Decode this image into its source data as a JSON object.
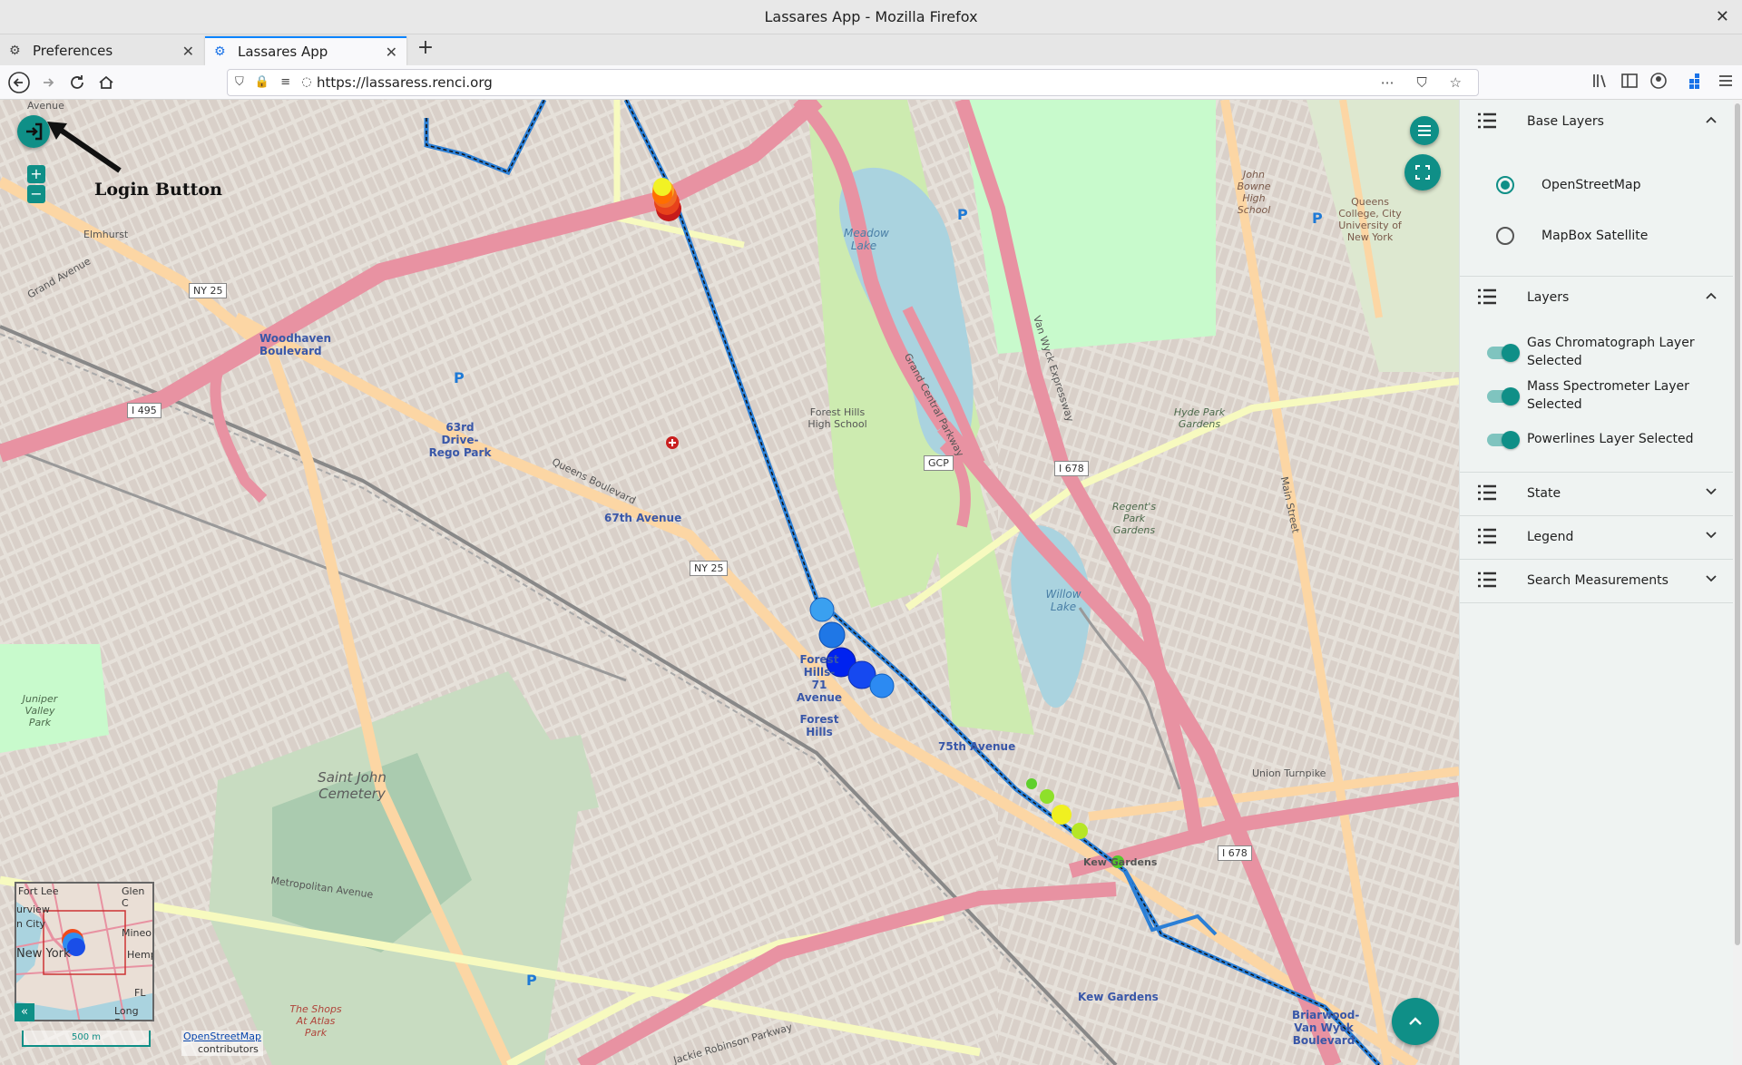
{
  "browser": {
    "window_title": "Lassares App - Mozilla Firefox",
    "close_glyph": "✕",
    "tabs": [
      {
        "label": "Preferences",
        "icon": "gear-icon",
        "glyph": "⚙"
      },
      {
        "label": "Lassares App",
        "icon": "app-icon",
        "glyph": "⚙"
      }
    ],
    "new_tab_glyph": "+",
    "tab_close_glyph": "✕",
    "url": "https://lassaress.renci.org",
    "url_icons": "⛉ 🔒 ≡ ◌",
    "url_actions": "⋯ ⛉ ☆"
  },
  "map": {
    "login_annotation": "Login Button",
    "login_glyph": "➜]",
    "zoom_in": "+",
    "zoom_out": "−",
    "menu_glyph": "≡",
    "fullscreen_glyph": "⛶",
    "scroll_top_glyph": "⌃",
    "minimap_toggle": "«",
    "scale_label": "500 m",
    "attribution_link": "OpenStreetMap",
    "attribution_text": "contributors",
    "labels": {
      "avenue": "Avenue",
      "elmhurst": "Elmhurst",
      "grand_avenue": "Grand Avenue",
      "queens_boulevard": "Queens Boulevard",
      "woodhaven": "Woodhaven Boulevard",
      "rego_park": "63rd Drive-Rego Park",
      "ave67": "67th Avenue",
      "forest_hills_hs": "Forest Hills High School",
      "forest_hills_station": "Forest Hills-71 Avenue",
      "forest_hills": "Forest Hills",
      "ave75": "75th Avenue",
      "meadow_lake": "Meadow Lake",
      "willow_lake": "Willow Lake",
      "grand_central": "Grand Central Parkway",
      "van_wyck": "Van Wyck Expressway",
      "saint_john": "Saint John Cemetery",
      "juniper": "Juniper Valley Park",
      "metropolitan": "Metropolitan Avenue",
      "union_turnpike": "Union Turnpike",
      "kew_gardens": "Kew Gardens",
      "kew_gardens_short": "Kew Gardens",
      "briarwood": "Briarwood-Van Wyck Boulevard",
      "queens_college": "Queens College, City University of New York",
      "john_bowne": "John Bowne High School",
      "main_street": "Main Street",
      "shops": "The Shops At Atlas Park",
      "jackie": "Jackie Robinson Parkway",
      "ny25": "NY 25",
      "ny25b": "NY 25",
      "i495": "I 495",
      "i678": "I 678",
      "i678b": "I 678",
      "gcp": "GCP",
      "hyde_park": "Hyde Park Gardens",
      "regency": "Regent's Park Gardens",
      "mm_ny": "New York",
      "mm_fort": "Fort Lee",
      "mm_glen": "Glen C",
      "mm_mine": "Mineo",
      "mm_hemp": "Hemp",
      "mm_long": "Long Bea",
      "mm_urv": "urview",
      "mm_city": "n City",
      "mm_fl": "FL"
    }
  },
  "panel": {
    "base_layers": {
      "title": "Base Layers",
      "options": [
        {
          "label": "OpenStreetMap",
          "selected": true
        },
        {
          "label": "MapBox Satellite",
          "selected": false
        }
      ]
    },
    "layers": {
      "title": "Layers",
      "toggles": [
        {
          "label": "Gas Chromatograph Layer Selected",
          "on": true
        },
        {
          "label": "Mass Spectrometer Layer Selected",
          "on": true
        },
        {
          "label": "Powerlines Layer Selected",
          "on": true
        }
      ]
    },
    "state": {
      "title": "State"
    },
    "legend": {
      "title": "Legend"
    },
    "search": {
      "title": "Search Measurements"
    },
    "chevron_up": "⌃",
    "chevron_down": "⌄"
  },
  "colors": {
    "accent": "#0f8f87",
    "major_road": "#e892a2",
    "secondary_road": "#fcd6a4",
    "water": "#aad3df",
    "park": "#c8facc",
    "cemetery": "#aacbaf"
  }
}
